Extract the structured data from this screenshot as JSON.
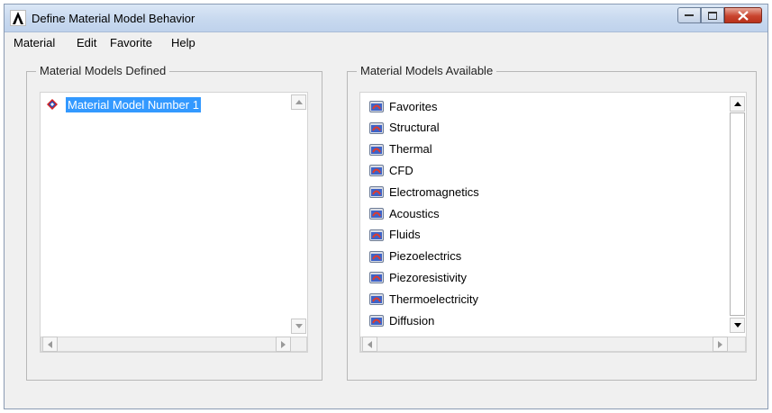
{
  "window": {
    "title": "Define Material Model Behavior"
  },
  "menu": [
    "Material",
    "Edit",
    "Favorite",
    "Help"
  ],
  "defined_panel": {
    "title": "Material Models Defined",
    "items": [
      {
        "label": "Material Model Number 1",
        "selected": true
      }
    ]
  },
  "available_panel": {
    "title": "Material Models Available",
    "items": [
      "Favorites",
      "Structural",
      "Thermal",
      "CFD",
      "Electromagnetics",
      "Acoustics",
      "Fluids",
      "Piezoelectrics",
      "Piezoresistivity",
      "Thermoelectricity",
      "Diffusion"
    ]
  },
  "colors": {
    "selection": "#3399ff",
    "titlebar": "#c8d9ef",
    "close_button": "#c9442e"
  },
  "icons": {
    "app": "ansys-logo-icon",
    "tree_item": "folder-icon",
    "material": "material-model-icon"
  }
}
